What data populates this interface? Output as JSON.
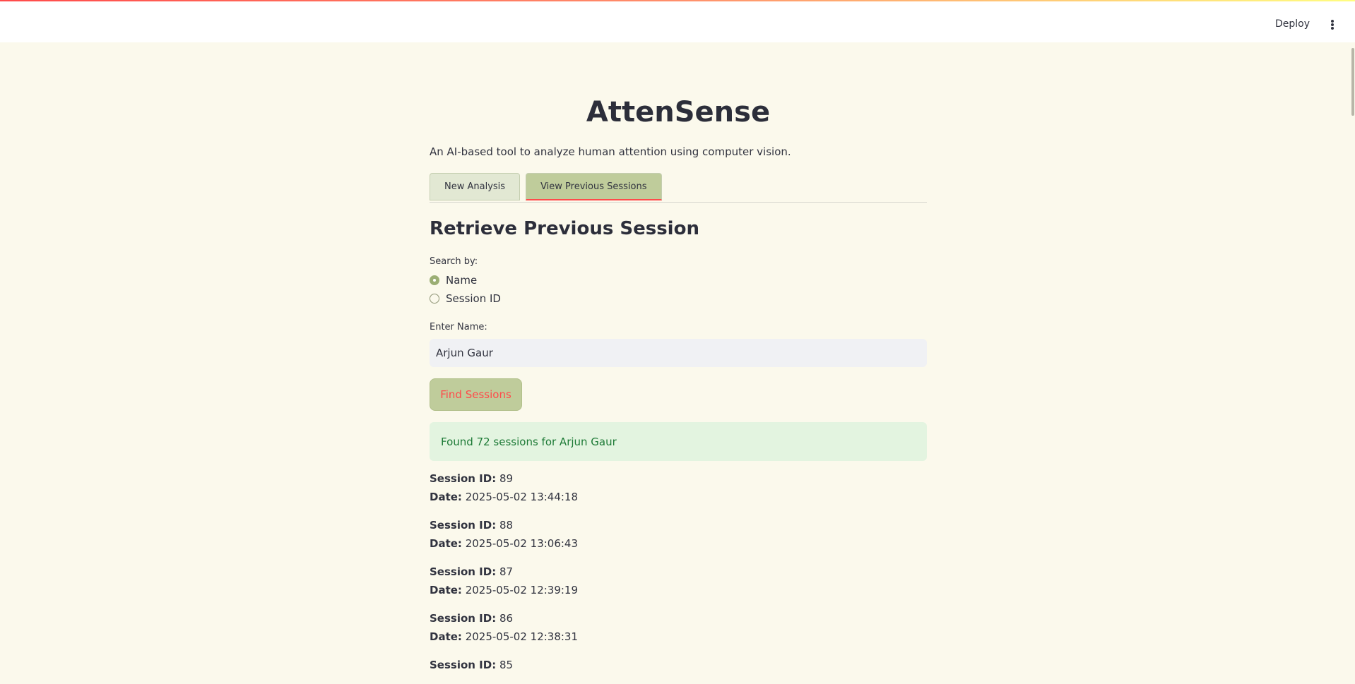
{
  "header": {
    "deploy_label": "Deploy"
  },
  "app": {
    "title": "AttenSense",
    "subtitle": "An AI-based tool to analyze human attention using computer vision."
  },
  "tabs": [
    {
      "label": "New Analysis",
      "active": false
    },
    {
      "label": "View Previous Sessions",
      "active": true
    }
  ],
  "retrieve": {
    "title": "Retrieve Previous Session",
    "search_by_label": "Search by:",
    "options": [
      {
        "label": "Name",
        "selected": true
      },
      {
        "label": "Session ID",
        "selected": false
      }
    ],
    "name_label": "Enter Name:",
    "name_value": "Arjun Gaur",
    "find_button": "Find Sessions",
    "success_message": "Found 72 sessions for Arjun Gaur"
  },
  "session_labels": {
    "id": "Session ID:",
    "date": "Date:"
  },
  "sessions": [
    {
      "id": "89",
      "date": "2025-05-02 13:44:18"
    },
    {
      "id": "88",
      "date": "2025-05-02 13:06:43"
    },
    {
      "id": "87",
      "date": "2025-05-02 12:39:19"
    },
    {
      "id": "86",
      "date": "2025-05-02 12:38:31"
    },
    {
      "id": "85",
      "date": ""
    }
  ],
  "colors": {
    "background": "#fbf9ec",
    "accent": "#bfcc9b",
    "primary_text_red": "#ff4b4b",
    "success_bg": "#e3f4e0",
    "success_text": "#1d7a36"
  }
}
